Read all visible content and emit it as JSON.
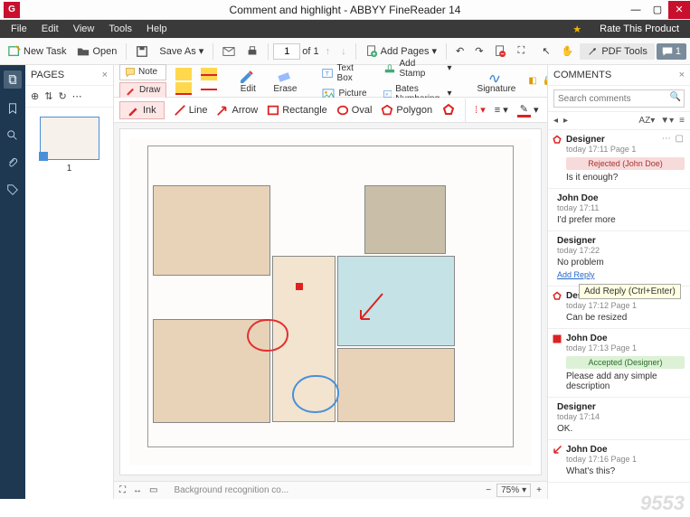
{
  "titlebar": {
    "title": "Comment and highlight - ABBYY FineReader 14"
  },
  "menu": {
    "file": "File",
    "edit": "Edit",
    "view": "View",
    "tools": "Tools",
    "help": "Help",
    "rate": "Rate This Product"
  },
  "toolbar": {
    "new_task": "New Task",
    "open": "Open",
    "save_as": "Save As",
    "page_current": "1",
    "page_of": "of 1",
    "add_pages": "Add Pages",
    "pdf_tools": "PDF Tools",
    "comments_count": "1"
  },
  "pages": {
    "title": "PAGES",
    "thumb_num": "1"
  },
  "ribbon": {
    "note": "Note",
    "draw": "Draw",
    "edit": "Edit",
    "erase": "Erase",
    "text_box": "Text Box",
    "picture": "Picture",
    "add_stamp": "Add Stamp",
    "bates": "Bates Numbering",
    "signature": "Signature"
  },
  "shapes": {
    "ink": "Ink",
    "line": "Line",
    "arrow": "Arrow",
    "rectangle": "Rectangle",
    "oval": "Oval",
    "polygon": "Polygon"
  },
  "status": {
    "bg": "Background recognition co...",
    "zoom": "75%"
  },
  "comments": {
    "title": "COMMENTS",
    "search_ph": "Search comments",
    "sort": "AZ",
    "tooltip": "Add Reply (Ctrl+Enter)",
    "add_reply": "Add Reply",
    "items": [
      {
        "author": "Designer",
        "meta": "today 17:11   Page 1",
        "status_label": "Rejected (John Doe)",
        "status": "rej",
        "body": "Is it enough?"
      },
      {
        "author": "John Doe",
        "meta": "today 17:11",
        "body": "I'd prefer more"
      },
      {
        "author": "Designer",
        "meta": "today 17:22",
        "body": "No problem"
      },
      {
        "author": "Desi",
        "meta": "today 17:12   Page 1",
        "body": "Can be resized"
      },
      {
        "author": "John Doe",
        "meta": "today 17:13   Page 1",
        "status_label": "Accepted (Designer)",
        "status": "acc",
        "body": "Please add any simple description"
      },
      {
        "author": "Designer",
        "meta": "today 17:14",
        "body": "OK."
      },
      {
        "author": "John Doe",
        "meta": "today 17:16   Page 1",
        "body": "What's this?"
      }
    ]
  },
  "watermark": "9553"
}
